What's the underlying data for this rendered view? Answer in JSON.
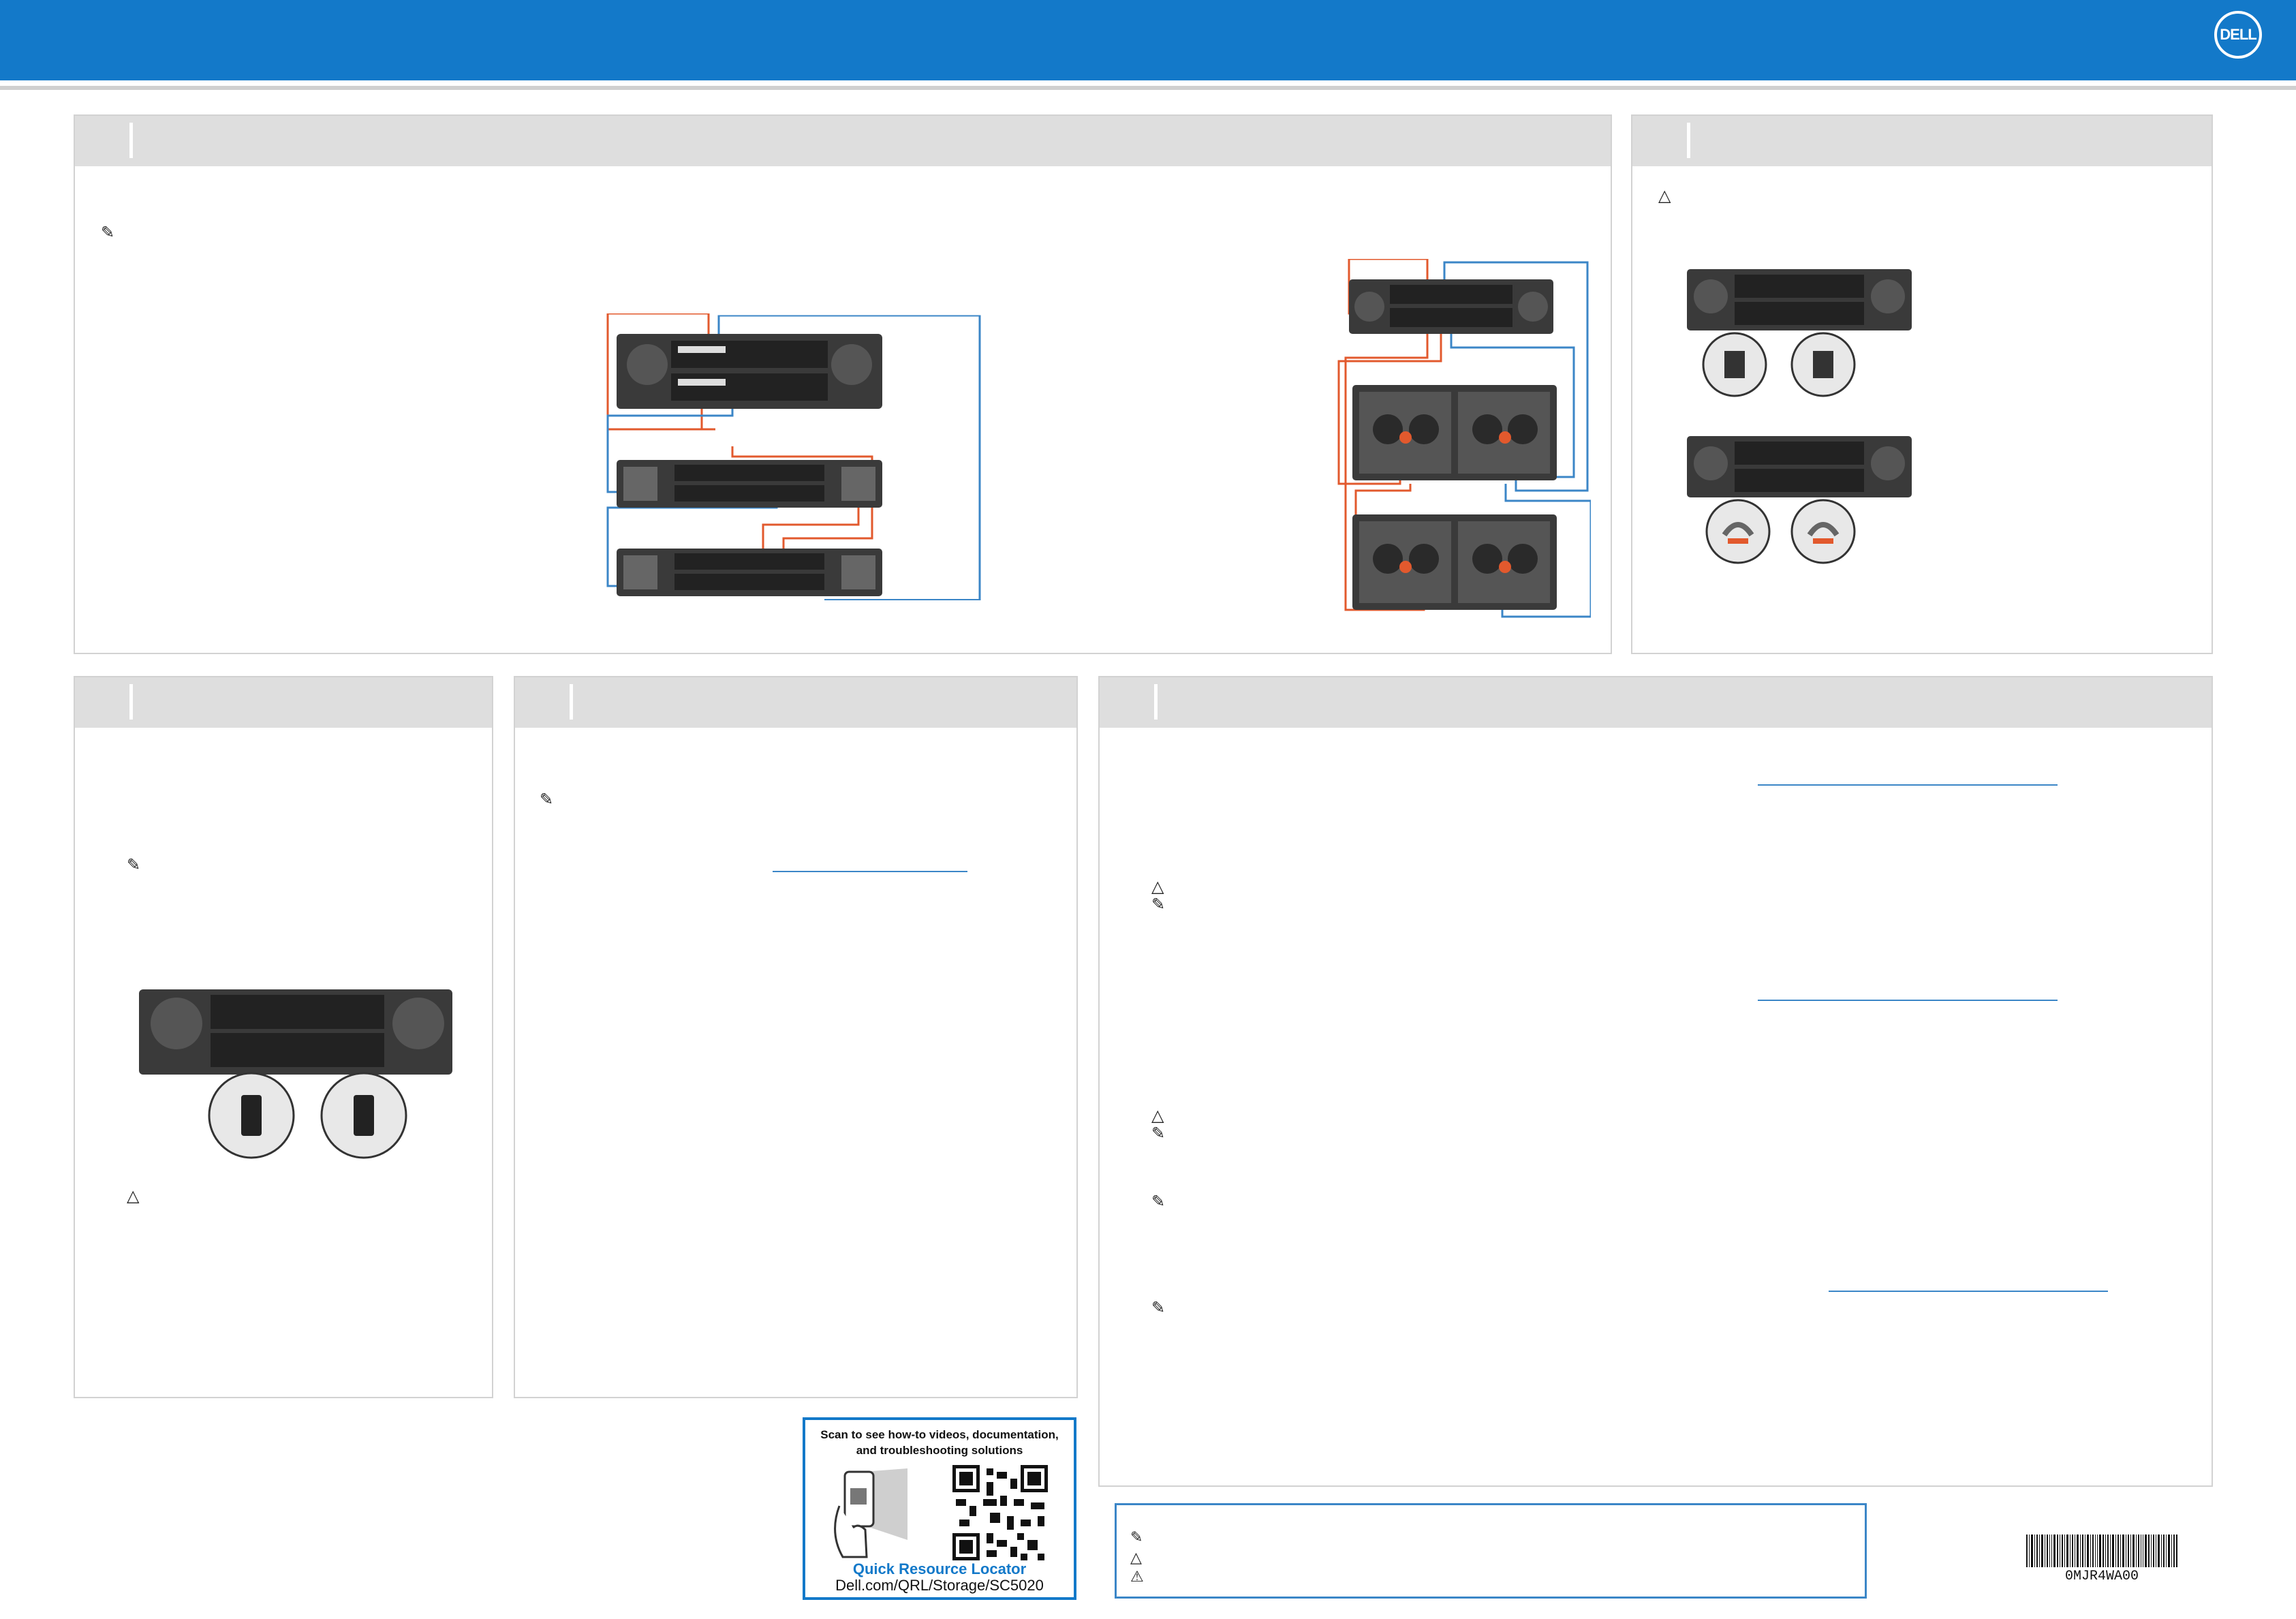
{
  "header": {
    "logo_text": "DELL",
    "brand_color": "#1379c9"
  },
  "qr": {
    "title_line1": "Scan to see how-to videos, documentation,",
    "title_line2": "and troubleshooting solutions",
    "label": "Quick Resource Locator",
    "url": "Dell.com/QRL/Storage/SC5020"
  },
  "barcode": {
    "text": "0MJR4WA00"
  },
  "icons": {
    "note": "note-icon",
    "caution": "caution-icon",
    "warning": "warning-icon"
  },
  "colors": {
    "cable_orange": "#e2592d",
    "cable_blue": "#3b86c7",
    "panel_header": "#dedede"
  }
}
